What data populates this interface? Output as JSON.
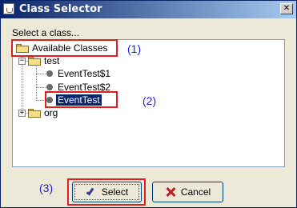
{
  "window": {
    "title": "Class Selector",
    "app_icon": "java-cup-icon",
    "close_label": "✕"
  },
  "prompt": "Select a class...",
  "tree": {
    "root": {
      "label": "Available Classes",
      "icon": "folder-open-icon"
    },
    "packages": [
      {
        "label": "test",
        "expanded": true,
        "expander": "−",
        "icon": "folder-open-icon",
        "classes": [
          {
            "label": "EventTest$1",
            "icon": "leaf-node-icon",
            "selected": false
          },
          {
            "label": "EventTest$2",
            "icon": "leaf-node-icon",
            "selected": false
          },
          {
            "label": "EventTest",
            "icon": "leaf-node-icon",
            "selected": true
          }
        ]
      },
      {
        "label": "org",
        "expanded": false,
        "expander": "+",
        "icon": "folder-icon",
        "classes": []
      }
    ]
  },
  "annotations": [
    {
      "id": "1",
      "label": "(1)",
      "target": "Available Classes"
    },
    {
      "id": "2",
      "label": "(2)",
      "target": "EventTest"
    },
    {
      "id": "3",
      "label": "(3)",
      "target": "Select"
    }
  ],
  "buttons": {
    "select_label": "Select",
    "select_icon": "checkmark-icon",
    "cancel_label": "Cancel",
    "cancel_icon": "red-x-icon"
  },
  "colors": {
    "title_gradient_start": "#0a246a",
    "title_gradient_end": "#a6caf0",
    "selection": "#0a246a",
    "annotation_box": "#e01e1e",
    "annotation_text": "#1f1fd6"
  }
}
